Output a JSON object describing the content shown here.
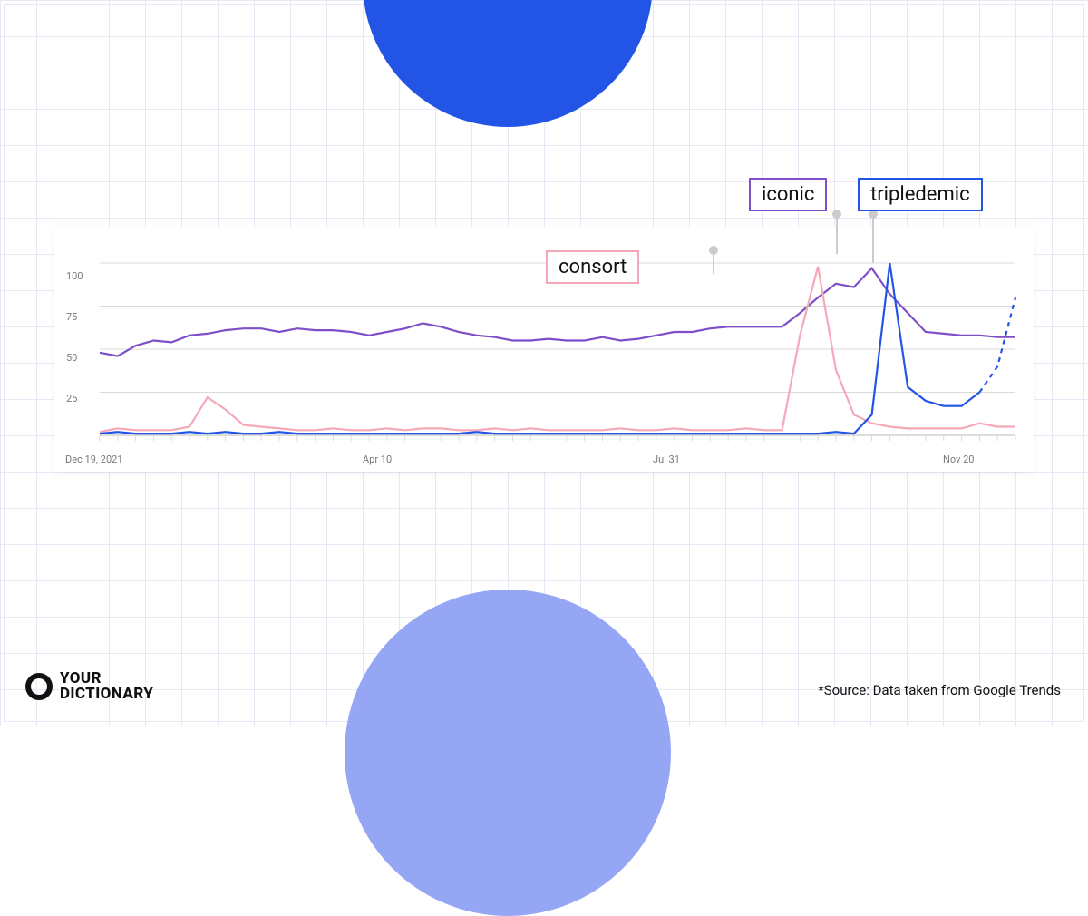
{
  "legend": {
    "consort": "consort",
    "iconic": "iconic",
    "tripledemic": "tripledemic"
  },
  "logo": {
    "line1": "YOUR",
    "line2": "DICTIONARY"
  },
  "source_note": "*Source: Data taken from Google Trends",
  "colors": {
    "consort": "#f5a9b8",
    "iconic": "#7d4fc9",
    "tripledemic": "#2255e6",
    "accent_circle_top": "#2255e6",
    "accent_circle_bottom": "#95a6f4",
    "grid": "#e6e9f5"
  },
  "chart_data": {
    "type": "line",
    "title": "",
    "xlabel": "",
    "ylabel": "",
    "ylim": [
      0,
      100
    ],
    "y_ticks": [
      25,
      50,
      75,
      100
    ],
    "x_tick_labels": [
      "Dec 19, 2021",
      "Apr 10",
      "Jul 31",
      "Nov 20"
    ],
    "series": [
      {
        "name": "iconic",
        "color": "#7d4fc9",
        "values": [
          48,
          46,
          52,
          55,
          54,
          58,
          59,
          61,
          62,
          62,
          60,
          62,
          61,
          61,
          60,
          58,
          60,
          62,
          65,
          63,
          60,
          58,
          57,
          55,
          55,
          56,
          55,
          55,
          57,
          55,
          56,
          58,
          60,
          60,
          62,
          63,
          63,
          63,
          63,
          71,
          80,
          88,
          86,
          97,
          82,
          71,
          60,
          59,
          58,
          58,
          57,
          57
        ]
      },
      {
        "name": "consort",
        "color": "#f5a9b8",
        "values": [
          2,
          4,
          3,
          3,
          3,
          5,
          22,
          15,
          6,
          5,
          4,
          3,
          3,
          4,
          3,
          3,
          4,
          3,
          4,
          4,
          3,
          3,
          4,
          3,
          4,
          3,
          3,
          3,
          3,
          4,
          3,
          3,
          4,
          3,
          3,
          3,
          4,
          3,
          3,
          58,
          98,
          38,
          12,
          7,
          5,
          4,
          4,
          4,
          4,
          7,
          5,
          5
        ]
      },
      {
        "name": "tripledemic",
        "color": "#2255e6",
        "values": [
          1,
          2,
          1,
          1,
          1,
          2,
          1,
          2,
          1,
          1,
          2,
          1,
          1,
          1,
          1,
          1,
          1,
          1,
          1,
          1,
          1,
          2,
          1,
          1,
          1,
          1,
          1,
          1,
          1,
          1,
          1,
          1,
          1,
          1,
          1,
          1,
          1,
          1,
          1,
          1,
          1,
          2,
          1,
          12,
          100,
          28,
          20,
          17,
          17,
          25,
          40,
          80
        ],
        "dashed_tail_points": 2
      }
    ]
  }
}
